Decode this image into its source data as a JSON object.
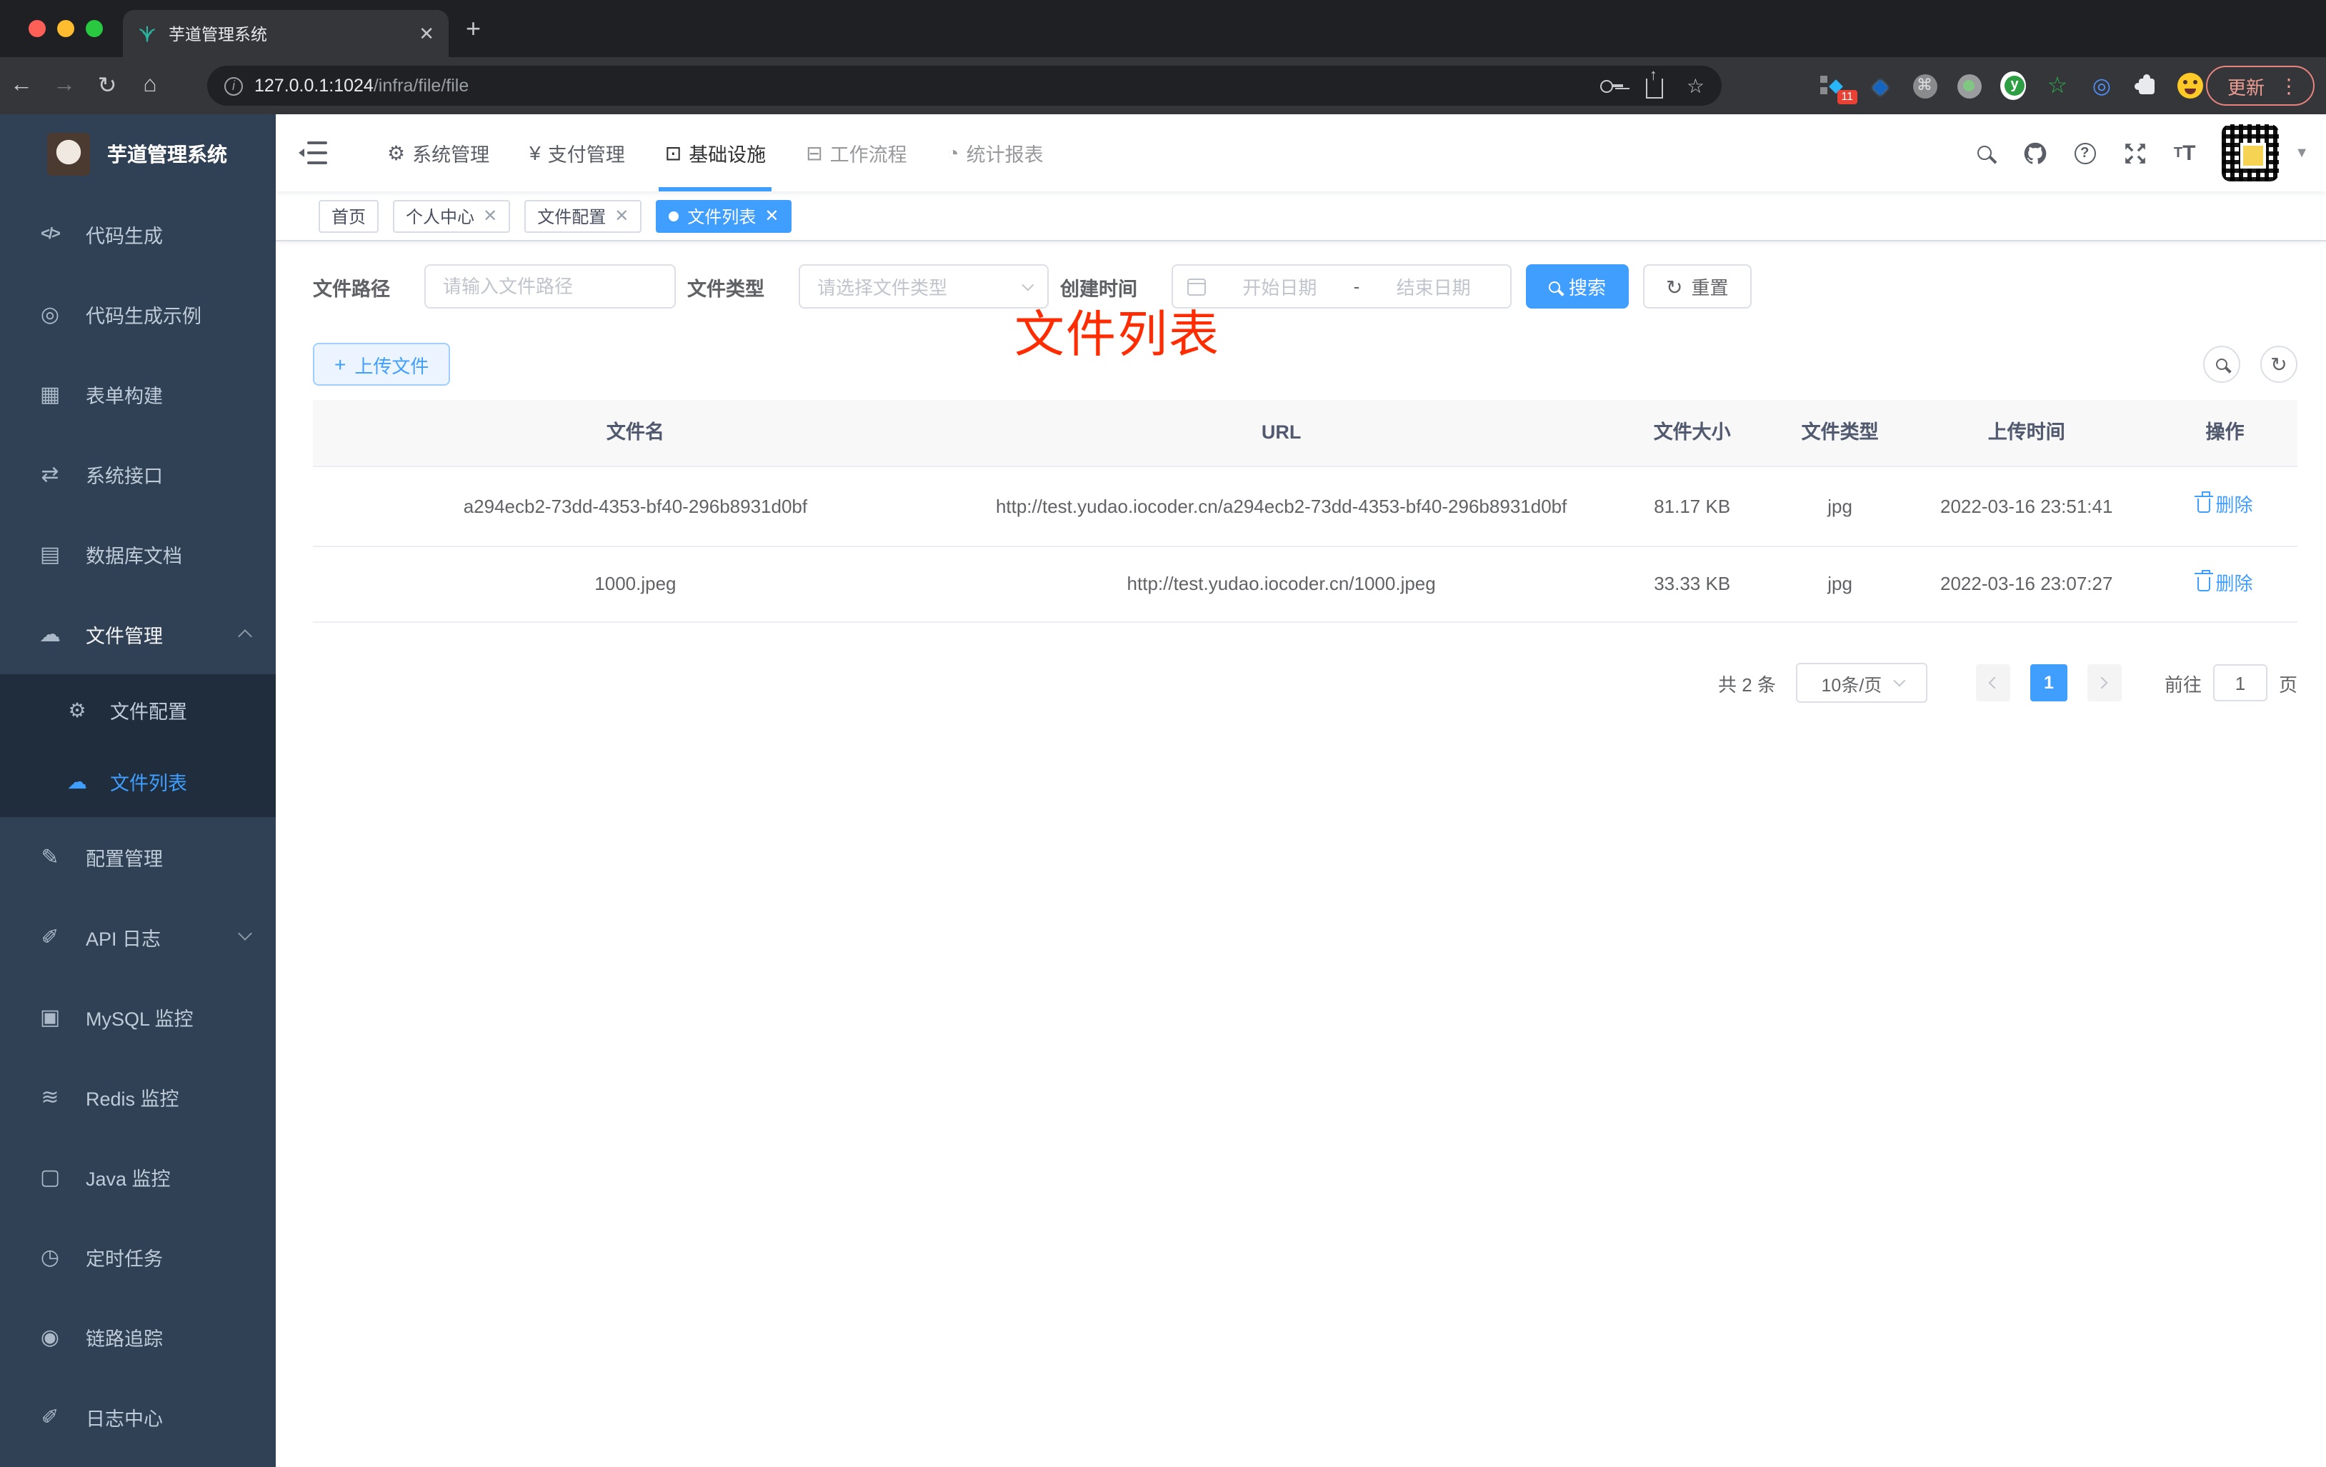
{
  "browser": {
    "tab_title": "芋道管理系统",
    "url_host": "127.0.0.1:1024",
    "url_path": "/infra/file/file",
    "update_label": "更新",
    "extension_badge": "11"
  },
  "sidebar": {
    "title": "芋道管理系统",
    "items": [
      {
        "label": "代码生成"
      },
      {
        "label": "代码生成示例"
      },
      {
        "label": "表单构建"
      },
      {
        "label": "系统接口"
      },
      {
        "label": "数据库文档"
      },
      {
        "label": "文件管理"
      },
      {
        "label": "文件配置"
      },
      {
        "label": "文件列表"
      },
      {
        "label": "配置管理"
      },
      {
        "label": "API 日志"
      },
      {
        "label": "MySQL 监控"
      },
      {
        "label": "Redis 监控"
      },
      {
        "label": "Java 监控"
      },
      {
        "label": "定时任务"
      },
      {
        "label": "链路追踪"
      },
      {
        "label": "日志中心"
      }
    ]
  },
  "topnav": {
    "items": [
      {
        "label": "系统管理"
      },
      {
        "label": "支付管理"
      },
      {
        "label": "基础设施"
      },
      {
        "label": "工作流程"
      },
      {
        "label": "统计报表"
      }
    ]
  },
  "tags": [
    {
      "label": "首页"
    },
    {
      "label": "个人中心"
    },
    {
      "label": "文件配置"
    },
    {
      "label": "文件列表"
    }
  ],
  "annotation": {
    "text": "文件列表",
    "color": "#fe2c00"
  },
  "filter": {
    "path_label": "文件路径",
    "path_placeholder": "请输入文件路径",
    "type_label": "文件类型",
    "type_placeholder": "请选择文件类型",
    "date_label": "创建时间",
    "date_start_placeholder": "开始日期",
    "date_separator": "-",
    "date_end_placeholder": "结束日期",
    "search_label": "搜索",
    "reset_label": "重置"
  },
  "toolbar": {
    "upload_label": "上传文件"
  },
  "table": {
    "columns": [
      "文件名",
      "URL",
      "文件大小",
      "文件类型",
      "上传时间",
      "操作"
    ],
    "rows": [
      {
        "name": "a294ecb2-73dd-4353-bf40-296b8931d0bf",
        "url": "http://test.yudao.iocoder.cn/a294ecb2-73dd-4353-bf40-296b8931d0bf",
        "size": "81.17 KB",
        "type": "jpg",
        "time": "2022-03-16 23:51:41",
        "action": "删除"
      },
      {
        "name": "1000.jpeg",
        "url": "http://test.yudao.iocoder.cn/1000.jpeg",
        "size": "33.33 KB",
        "type": "jpg",
        "time": "2022-03-16 23:07:27",
        "action": "删除"
      }
    ]
  },
  "pagination": {
    "total": "共 2 条",
    "page_size": "10条/页",
    "current_page": "1",
    "goto_label": "前往",
    "goto_value": "1",
    "page_unit": "页"
  },
  "colors": {
    "accent": "#409eff",
    "sidebar_bg": "#304156",
    "submenu_bg": "#1f2d3d"
  }
}
